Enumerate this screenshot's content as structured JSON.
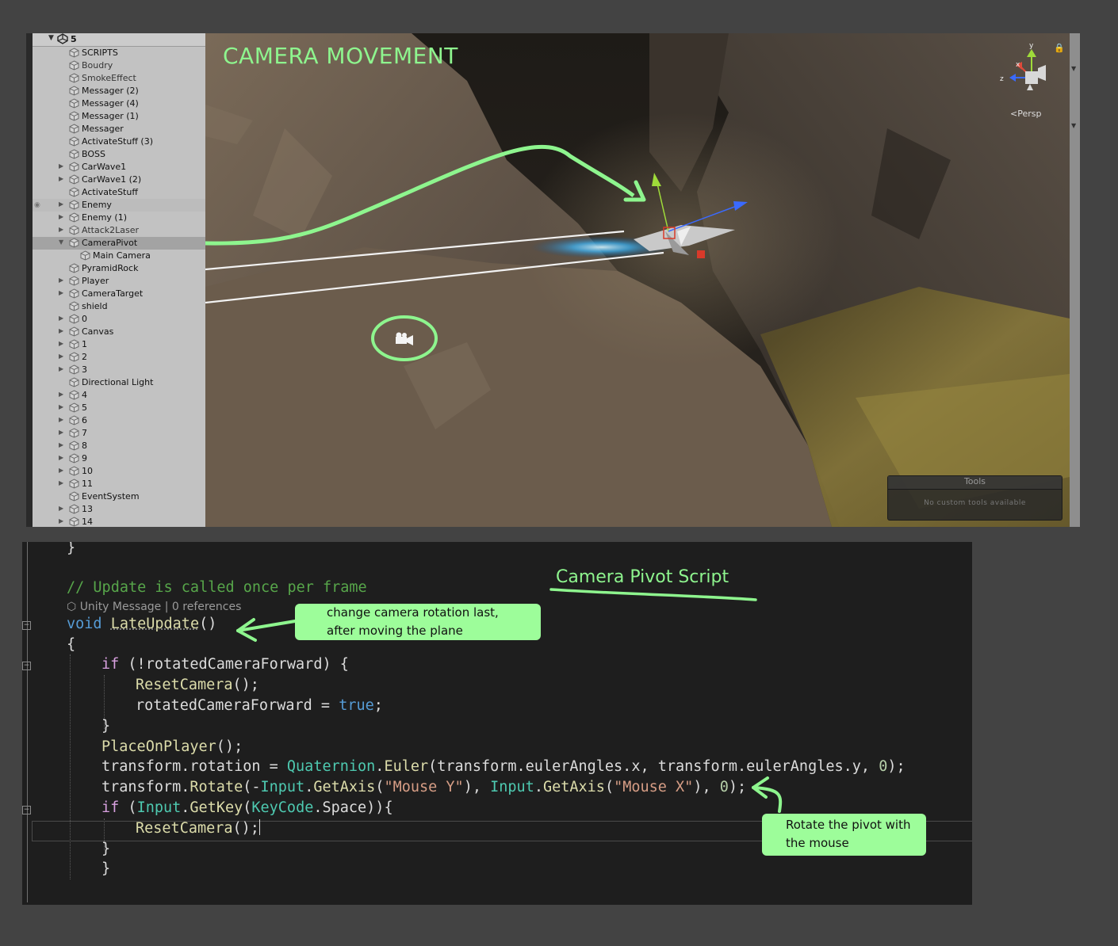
{
  "hierarchy": {
    "scene_name": "5",
    "items": [
      {
        "label": "SCRIPTS",
        "expandable": false
      },
      {
        "label": "Boudry",
        "expandable": false
      },
      {
        "label": "SmokeEffect",
        "expandable": false
      },
      {
        "label": "Messager (2)",
        "expandable": false
      },
      {
        "label": "Messager (4)",
        "expandable": false
      },
      {
        "label": "Messager (1)",
        "expandable": false
      },
      {
        "label": "Messager",
        "expandable": false
      },
      {
        "label": "ActivateStuff (3)",
        "expandable": false
      },
      {
        "label": "BOSS",
        "expandable": false
      },
      {
        "label": "CarWave1",
        "expandable": true
      },
      {
        "label": "CarWave1 (2)",
        "expandable": true
      },
      {
        "label": "ActivateStuff",
        "expandable": false
      },
      {
        "label": "Enemy",
        "expandable": true
      },
      {
        "label": "Enemy (1)",
        "expandable": true
      },
      {
        "label": "Attack2Laser",
        "expandable": true
      },
      {
        "label": "CameraPivot",
        "expandable": true,
        "expanded": true
      },
      {
        "label": "Main Camera",
        "expandable": false,
        "child": true
      },
      {
        "label": "PyramidRock",
        "expandable": false
      },
      {
        "label": "Player",
        "expandable": true
      },
      {
        "label": "CameraTarget",
        "expandable": true
      },
      {
        "label": "shield",
        "expandable": false
      },
      {
        "label": "0",
        "expandable": true
      },
      {
        "label": "Canvas",
        "expandable": true
      },
      {
        "label": "1",
        "expandable": true
      },
      {
        "label": "2",
        "expandable": true
      },
      {
        "label": "3",
        "expandable": true
      },
      {
        "label": "Directional Light",
        "expandable": false
      },
      {
        "label": "4",
        "expandable": true
      },
      {
        "label": "5",
        "expandable": true
      },
      {
        "label": "6",
        "expandable": true
      },
      {
        "label": "7",
        "expandable": true
      },
      {
        "label": "8",
        "expandable": true
      },
      {
        "label": "9",
        "expandable": true
      },
      {
        "label": "10",
        "expandable": true
      },
      {
        "label": "11",
        "expandable": true
      },
      {
        "label": "EventSystem",
        "expandable": false
      },
      {
        "label": "13",
        "expandable": true
      },
      {
        "label": "14",
        "expandable": true
      }
    ]
  },
  "scene": {
    "annotation_title": "CAMERA MOVEMENT",
    "gizmo_axis_y": "y",
    "gizmo_axis_x": "x",
    "gizmo_axis_z": "z",
    "projection_label": "Persp",
    "tools_title": "Tools",
    "tools_message": "No custom tools available"
  },
  "code": {
    "annotation_title": "Camera Pivot Script",
    "codelens": "Unity Message | 0 references",
    "lines": {
      "l0": "}",
      "l2_comment": "// Update is called once per frame",
      "l3_void": "void",
      "l3_name": "LateUpdate",
      "l3_rest": "()",
      "l4": "{",
      "l5_if": "if",
      "l5_rest": " (!rotatedCameraForward) {",
      "l6_fn": "ResetCamera",
      "l6_rest": "();",
      "l7_a": "rotatedCameraForward = ",
      "l7_true": "true",
      "l7_b": ";",
      "l8": "}",
      "l9_fn": "PlaceOnPlayer",
      "l9_rest": "();",
      "l10_a": "transform.rotation = ",
      "l10_ty": "Quaternion",
      "l10_b": ".",
      "l10_fn": "Euler",
      "l10_c": "(transform.eulerAngles.x, transform.eulerAngles.y, ",
      "l10_num": "0",
      "l10_d": ");",
      "l11_a": "transform.",
      "l11_fn1": "Rotate",
      "l11_b": "(-",
      "l11_ty1": "Input",
      "l11_c": ".",
      "l11_fn2": "GetAxis",
      "l11_d": "(",
      "l11_s1": "\"Mouse Y\"",
      "l11_e": "), ",
      "l11_ty2": "Input",
      "l11_f": ".",
      "l11_fn3": "GetAxis",
      "l11_g": "(",
      "l11_s2": "\"Mouse X\"",
      "l11_h": "), ",
      "l11_num": "0",
      "l11_i": ");",
      "l12_if": "if",
      "l12_a": " (",
      "l12_ty1": "Input",
      "l12_b": ".",
      "l12_fn": "GetKey",
      "l12_c": "(",
      "l12_ty2": "KeyCode",
      "l12_d": ".Space)){",
      "l13_fn": "ResetCamera",
      "l13_rest": "();",
      "l14": "}",
      "l15": "}"
    }
  },
  "callouts": {
    "lateupdate_line1": "change camera rotation last,",
    "lateupdate_line2": "after moving the plane",
    "rotate_line1": "Rotate the pivot with",
    "rotate_line2": "the mouse"
  },
  "colors": {
    "annotation_green": "#8ef58e",
    "callout_bg": "#9dfd9a",
    "code_bg": "#1e1e1e",
    "hierarchy_bg": "#c2c2c2"
  }
}
